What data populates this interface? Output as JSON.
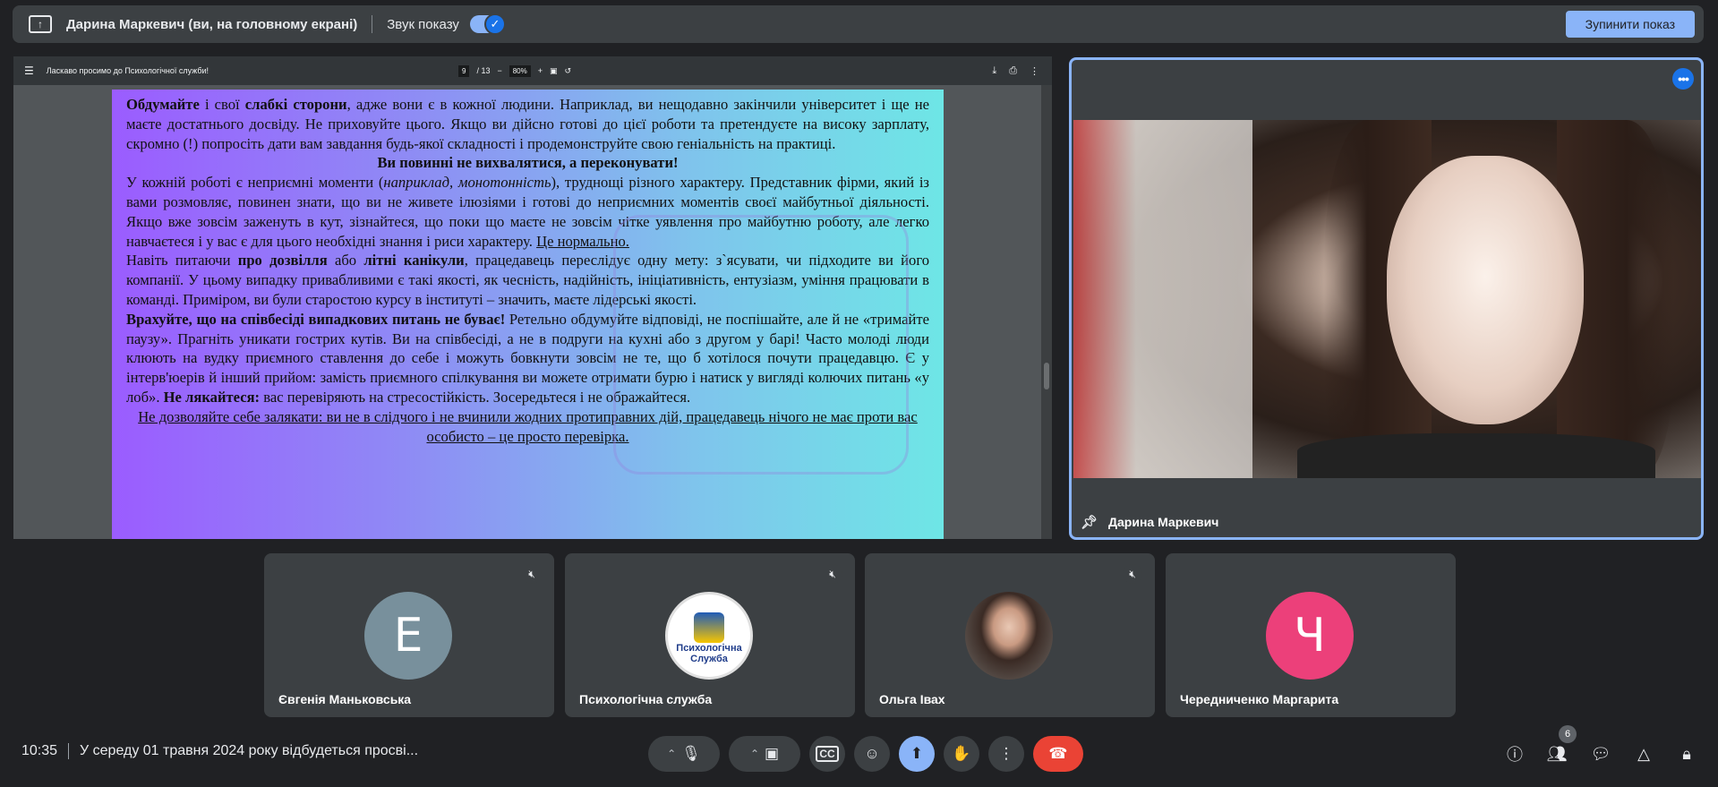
{
  "topbar": {
    "presenter": "Дарина Маркевич (ви, на головному екрані)",
    "sound_label": "Звук показу",
    "stop_label": "Зупинити показ"
  },
  "pdf": {
    "title": "Ласкаво просимо до Психологічної служби!",
    "page_current": "9",
    "page_total": "/ 13",
    "zoom": "80%",
    "paragraphs": {
      "p1_b1": "Обдумайте",
      "p1_t1": " і свої ",
      "p1_b2": "слабкі сторони",
      "p1_t2": ", адже вони є в кожної людини. Наприклад, ви нещодавно закінчили університет і ще не маєте достатнього досвіду. Не приховуйте цього. Якщо ви дійсно готові до цієї роботи та претендуєте на високу зарплату, скромно (!) попросіть дати вам завдання будь-якої складності і продемонструйте свою геніальність на практиці.",
      "p2": "Ви повинні не вихвалятися, а переконувати!",
      "p3_t1": "У кожній роботі є неприємні моменти (",
      "p3_i": "наприклад, монотонність",
      "p3_t2": "), труднощі різного характеру. Представник фірми, який із вами розмовляє, повинен знати, що ви не живете ілюзіями і готові до неприємних моментів своєї майбутньої діяльності. Якщо вже зовсім заженуть в кут, зізнайтеся, що поки що маєте не зовсім чітке уявлення про майбутню роботу, але легко навчаєтеся і у вас є для цього необхідні знання і риси характеру. ",
      "p3_u": "Це нормально.",
      "p4_t1": "Навіть питаючи ",
      "p4_b1": "про дозвілля",
      "p4_t2": " або ",
      "p4_b2": "літні канікули",
      "p4_t3": ", працедавець переслідує одну мету: з`ясувати, чи підходите ви його компанії. У цьому випадку привабливими є такі якості, як чесність, надійність, ініціативність, ентузіазм, уміння працювати в команді. Приміром, ви були старостою курсу в інституті – значить, маєте лідерські якості.",
      "p5_b1": "Врахуйте, що на співбесіді випадкових питань не буває!",
      "p5_t1": " Ретельно обдумуйте відповіді, не поспішайте, але й не «тримайте паузу». Прагніть уникати гострих кутів. Ви на співбесіді, а не в подруги на кухні або з другом у барі! Часто молоді люди клюють на вудку приємного ставлення до себе і можуть бовкнути зовсім не те, що б хотілося почути працедавцю. Є у інтерв'юерів й інший прийом: замість приємного спілкування ви можете отримати бурю і натиск у вигляді колючих питань «у лоб». ",
      "p5_b2": "Не лякайтеся:",
      "p5_t2": " вас перевіряють на стресостійкість. Зосередьтеся і не ображайтеся.",
      "p6": "Не дозволяйте себе залякати: ви не в слідчого і не вчинили жодних протиправних дій, працедавець нічого не має проти вас особисто – це просто перевірка."
    }
  },
  "main_tile": {
    "name": "Дарина Маркевич"
  },
  "participants": [
    {
      "name": "Євгенія Маньковська",
      "initial": "Е",
      "color": "#78909c"
    },
    {
      "name": "Психологічна служба",
      "logo_text": "Психологічна Служба"
    },
    {
      "name": "Ольга Івах"
    },
    {
      "name": "Чередниченко Маргарита",
      "initial": "Ч",
      "color": "#ec407a"
    }
  ],
  "bottom": {
    "time": "10:35",
    "meeting_title": "У середу 01 травня 2024 року відбудеться просві...",
    "people_count": "6"
  },
  "icons": {
    "present": "present-to-all-icon",
    "pin": "pin-icon",
    "mic_off": "mic-off-icon",
    "mic": "mic-icon",
    "camera": "camera-icon",
    "captions": "closed-captions-icon",
    "emoji": "emoji-icon",
    "raise_hand": "raise-hand-icon",
    "more": "more-vert-icon",
    "hangup": "call-end-icon",
    "info": "info-icon",
    "people": "people-icon",
    "chat": "chat-icon",
    "activities": "activities-icon",
    "host_controls": "host-controls-icon"
  }
}
